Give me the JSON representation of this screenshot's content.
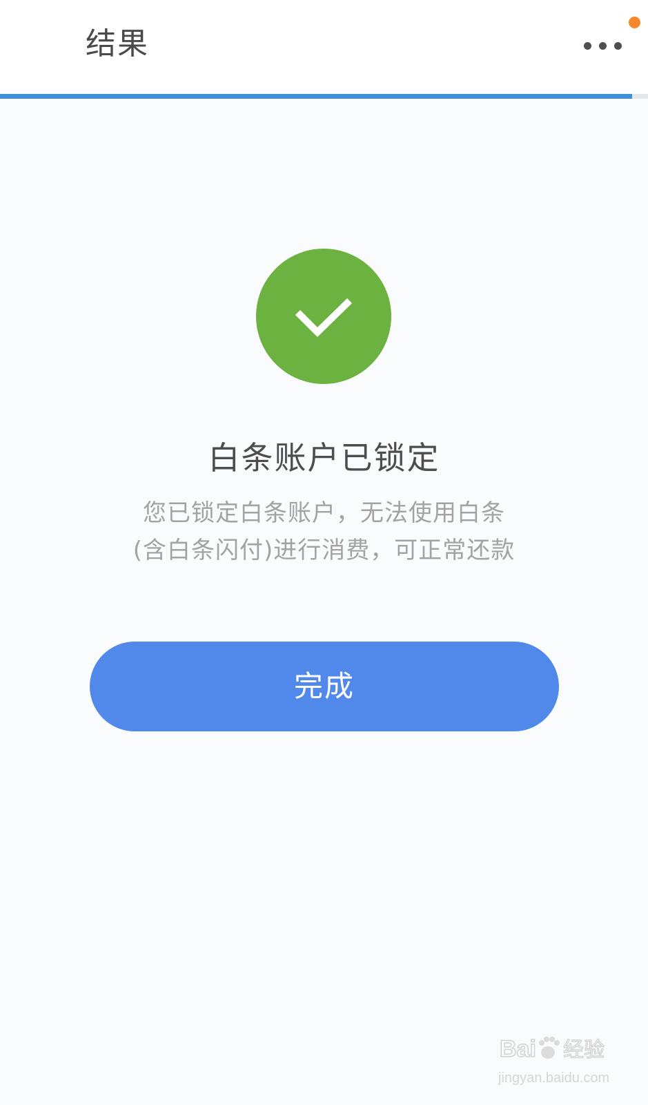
{
  "header": {
    "title": "结果",
    "more_icon": "more-horizontal-icon",
    "notification_color": "#f5882b"
  },
  "progress": {
    "value": 0.975,
    "color": "#3d8fd8"
  },
  "result": {
    "icon": "checkmark-circle-icon",
    "icon_color": "#6bb240",
    "title": "白条账户已锁定",
    "description_line1": "您已锁定白条账户，无法使用白条",
    "description_line2": "(含白条闪付)进行消费，可正常还款"
  },
  "actions": {
    "done_label": "完成",
    "done_color": "#5189ea"
  },
  "watermark": {
    "logo_text": "Bai经验",
    "url": "jingyan.baidu.com"
  }
}
